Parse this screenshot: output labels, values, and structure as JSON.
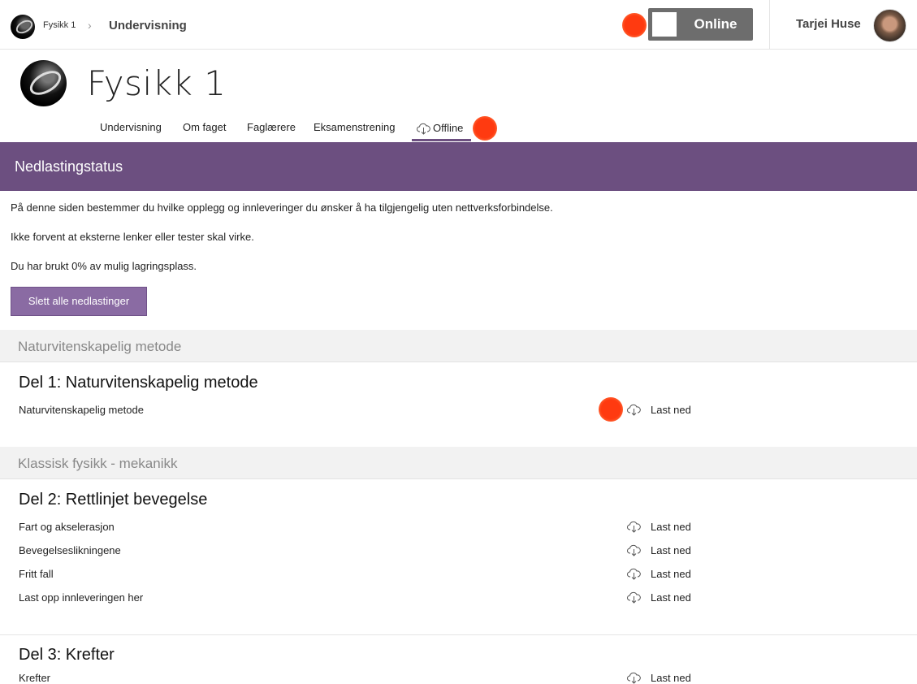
{
  "topbar": {
    "course": "Fysikk 1",
    "section": "Undervisning",
    "toggle_label": "Online",
    "user_name": "Tarjei Huse"
  },
  "course": {
    "title": "Fysikk 1",
    "tabs": [
      "Undervisning",
      "Om faget",
      "Faglærere",
      "Eksamenstrening"
    ],
    "active_tab": "Offline"
  },
  "page": {
    "header": "Nedlastingstatus",
    "info": [
      "På denne siden bestemmer du hvilke opplegg og innleveringer du ønsker å ha tilgjengelig uten nettverksforbindelse.",
      "Ikke forvent at eksterne lenker eller tester skal virke.",
      "Du har brukt 0% av mulig lagringsplass."
    ],
    "delete_button": "Slett alle nedlastinger"
  },
  "sections": [
    {
      "name": "Naturvitenskapelig metode",
      "parts": [
        {
          "title": "Del 1: Naturvitenskapelig metode",
          "items": [
            {
              "label": "Naturvitenskapelig metode",
              "action": "Last ned"
            }
          ]
        }
      ]
    },
    {
      "name": "Klassisk fysikk - mekanikk",
      "parts": [
        {
          "title": "Del 2: Rettlinjet bevegelse",
          "items": [
            {
              "label": "Fart og akselerasjon",
              "action": "Last ned"
            },
            {
              "label": "Bevegelseslikningene",
              "action": "Last ned"
            },
            {
              "label": "Fritt fall",
              "action": "Last ned"
            },
            {
              "label": "Last opp innleveringen her",
              "action": "Last ned"
            }
          ]
        },
        {
          "title": "Del 3: Krefter",
          "items": [
            {
              "label": "Krefter",
              "action": "Last ned"
            }
          ]
        }
      ]
    }
  ],
  "icons": {
    "download": "cloud-download-icon",
    "chevron": "chevron-right-icon"
  },
  "colors": {
    "accent": "#6c4f80",
    "button": "#8a6ba3",
    "indicator": "#ff3a10",
    "toggle": "#6d6d6d"
  }
}
